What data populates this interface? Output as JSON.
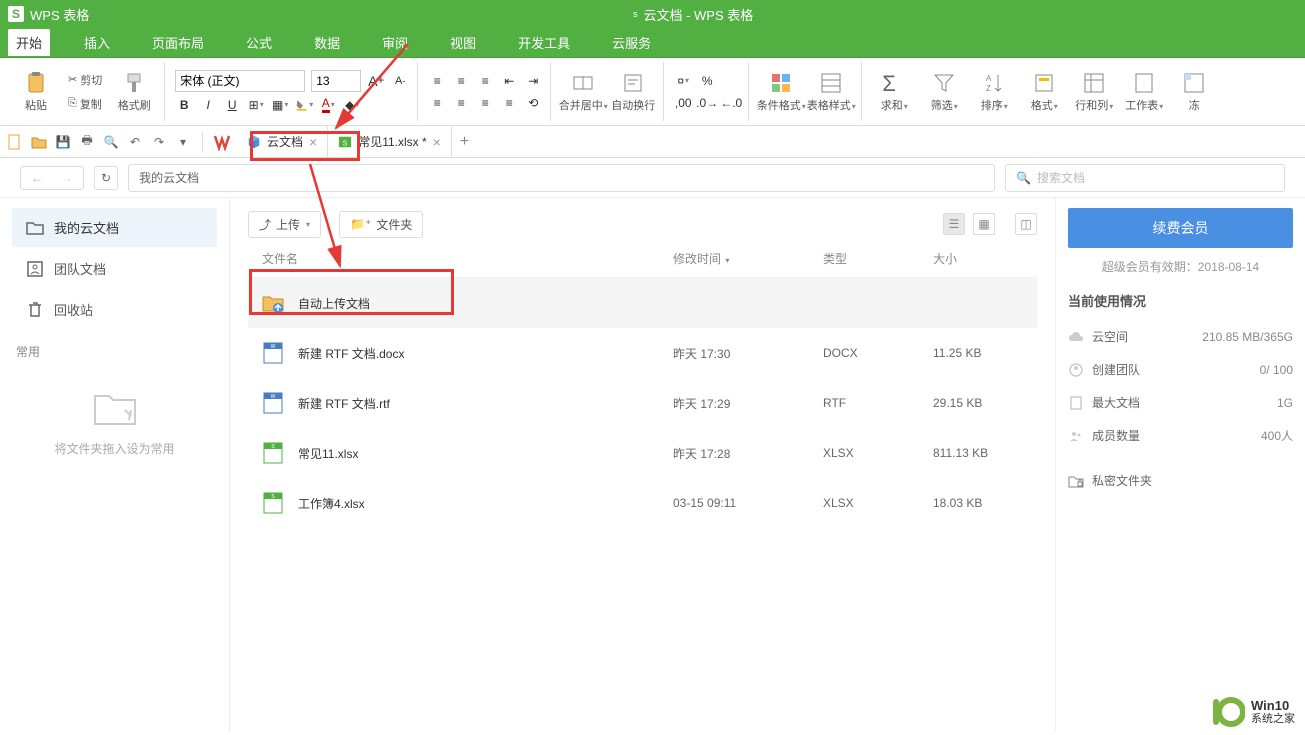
{
  "app": {
    "title": "WPS 表格",
    "doc_title_prefix": "s",
    "doc_title": "云文档 - WPS 表格"
  },
  "menu": {
    "items": [
      "开始",
      "插入",
      "页面布局",
      "公式",
      "数据",
      "审阅",
      "视图",
      "开发工具",
      "云服务"
    ],
    "active": 0
  },
  "ribbon": {
    "paste": "粘贴",
    "cut": "剪切",
    "copy": "复制",
    "format_painter": "格式刷",
    "font_name": "宋体 (正文)",
    "font_size": "13",
    "merge": "合并居中",
    "wrap": "自动换行",
    "cond_format": "条件格式",
    "cell_style": "表格样式",
    "sum": "求和",
    "filter": "筛选",
    "sort": "排序",
    "format": "格式",
    "row_col": "行和列",
    "sheet": "工作表",
    "freeze": "冻"
  },
  "tabs": {
    "cloud": "云文档",
    "file": "常见11.xlsx *"
  },
  "nav": {
    "path": "我的云文档",
    "search_placeholder": "搜索文档"
  },
  "sidebar": {
    "items": [
      {
        "label": "我的云文档",
        "icon": "folder"
      },
      {
        "label": "团队文档",
        "icon": "team"
      },
      {
        "label": "回收站",
        "icon": "trash"
      }
    ],
    "common_label": "常用",
    "drop_hint": "将文件夹拖入设为常用"
  },
  "toolbar": {
    "upload": "上传",
    "new_folder": "文件夹"
  },
  "columns": {
    "name": "文件名",
    "time": "修改时间",
    "type": "类型",
    "size": "大小"
  },
  "files": [
    {
      "name": "自动上传文档",
      "time": "",
      "type": "",
      "size": "",
      "icon": "folder-upload",
      "highlighted": true
    },
    {
      "name": "新建 RTF 文档.docx",
      "time": "昨天 17:30",
      "type": "DOCX",
      "size": "11.25 KB",
      "icon": "docx"
    },
    {
      "name": "新建 RTF 文档.rtf",
      "time": "昨天 17:29",
      "type": "RTF",
      "size": "29.15 KB",
      "icon": "rtf"
    },
    {
      "name": "常见11.xlsx",
      "time": "昨天 17:28",
      "type": "XLSX",
      "size": "811.13 KB",
      "icon": "xlsx"
    },
    {
      "name": "工作簿4.xlsx",
      "time": "03-15 09:11",
      "type": "XLSX",
      "size": "18.03 KB",
      "icon": "xlsx"
    }
  ],
  "right": {
    "renew": "续费会员",
    "expire": "超级会员有效期：2018-08-14",
    "usage_title": "当前使用情况",
    "rows": [
      {
        "label": "云空间",
        "value": "210.85 MB/365G",
        "icon": "cloud"
      },
      {
        "label": "创建团队",
        "value": "0/ 100",
        "icon": "team"
      },
      {
        "label": "最大文档",
        "value": "1G",
        "icon": "doc"
      },
      {
        "label": "成员数量",
        "value": "400人",
        "icon": "people"
      }
    ],
    "private": "私密文件夹"
  },
  "watermark": {
    "line1": "Win10",
    "line2": "系统之家"
  }
}
